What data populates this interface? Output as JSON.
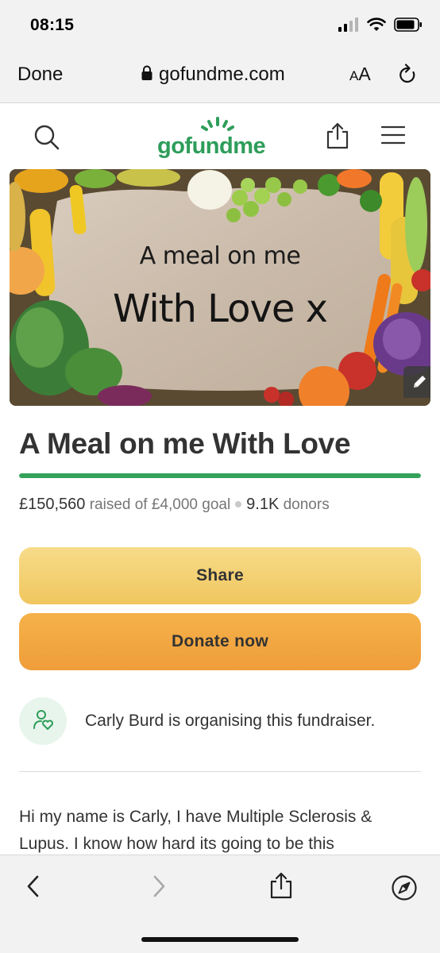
{
  "status_bar": {
    "time": "08:15"
  },
  "browser": {
    "done_label": "Done",
    "url": "gofundme.com",
    "text_size_label_small": "A",
    "text_size_label_large": "A"
  },
  "site": {
    "logo_text": "gofundme"
  },
  "hero": {
    "line1": "A meal on me",
    "line2": "With Love x"
  },
  "campaign": {
    "title": "A Meal on me With Love",
    "raised_amount": "£150,560",
    "raised_suffix": "raised of £4,000 goal",
    "donors_count": "9.1K",
    "donors_label": "donors",
    "progress_fraction": 1.0
  },
  "actions": {
    "share_label": "Share",
    "donate_label": "Donate now"
  },
  "organiser": {
    "text": "Carly Burd is organising this fundraiser."
  },
  "story": {
    "text": "Hi my name is Carly, I have Multiple Sclerosis & Lupus. I know how hard its going to be this"
  },
  "colors": {
    "brand_green": "#2e9d5a",
    "progress_green": "#34a35a",
    "share_button": "#f0c65e",
    "donate_button": "#ef9d3a"
  },
  "icons": {
    "status": [
      "signal-icon",
      "wifi-icon",
      "battery-icon"
    ],
    "browser": [
      "lock-icon",
      "reload-icon"
    ],
    "site_header": [
      "search-icon",
      "share-icon",
      "menu-icon"
    ],
    "hero": [
      "edit-icon"
    ],
    "organiser": [
      "organiser-heart-icon"
    ],
    "bottom_bar": [
      "back-icon",
      "forward-icon",
      "share-icon",
      "compass-icon"
    ]
  }
}
